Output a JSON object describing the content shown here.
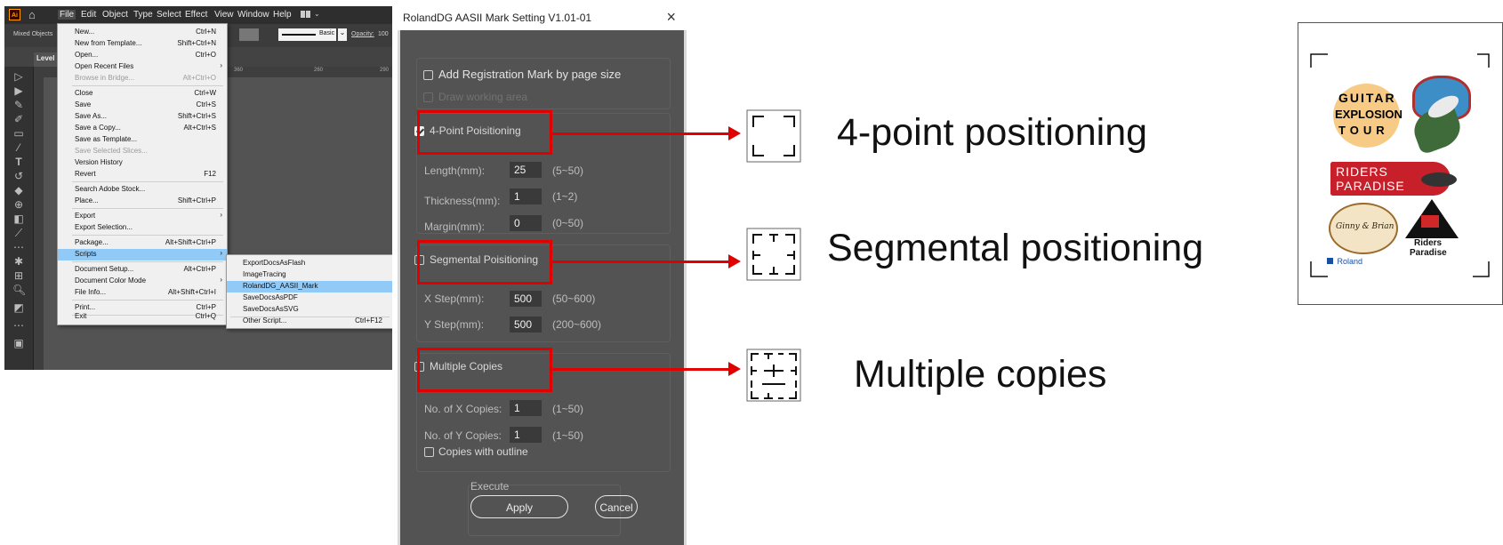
{
  "illustrator": {
    "logo": "Ai",
    "menubar": [
      "File",
      "Edit",
      "Object",
      "Type",
      "Select",
      "Effect",
      "View",
      "Window",
      "Help"
    ],
    "control_bar": {
      "left_label": "Mixed Objects",
      "stroke_style": "Basic",
      "opacity_label": "Opacity:",
      "opacity_value": "100"
    },
    "doc_tab": "Level",
    "ruler_numbers": [
      "360",
      "260",
      "290"
    ],
    "file_menu": [
      {
        "label": "New...",
        "shortcut": "Ctrl+N"
      },
      {
        "label": "New from Template...",
        "shortcut": "Shift+Ctrl+N"
      },
      {
        "label": "Open...",
        "shortcut": "Ctrl+O"
      },
      {
        "label": "Open Recent Files",
        "shortcut": ""
      },
      {
        "label": "Browse in Bridge...",
        "shortcut": "Alt+Ctrl+O"
      },
      {
        "label": "Close",
        "shortcut": "Ctrl+W"
      },
      {
        "label": "Save",
        "shortcut": "Ctrl+S"
      },
      {
        "label": "Save As...",
        "shortcut": "Shift+Ctrl+S"
      },
      {
        "label": "Save a Copy...",
        "shortcut": "Alt+Ctrl+S"
      },
      {
        "label": "Save as Template...",
        "shortcut": ""
      },
      {
        "label": "Save Selected Slices...",
        "shortcut": ""
      },
      {
        "label": "Version History",
        "shortcut": ""
      },
      {
        "label": "Revert",
        "shortcut": "F12"
      },
      {
        "label": "Search Adobe Stock...",
        "shortcut": ""
      },
      {
        "label": "Place...",
        "shortcut": "Shift+Ctrl+P"
      },
      {
        "label": "Export",
        "shortcut": ""
      },
      {
        "label": "Export Selection...",
        "shortcut": ""
      },
      {
        "label": "Package...",
        "shortcut": "Alt+Shift+Ctrl+P"
      },
      {
        "label": "Scripts",
        "shortcut": ""
      },
      {
        "label": "Document Setup...",
        "shortcut": "Alt+Ctrl+P"
      },
      {
        "label": "Document Color Mode",
        "shortcut": ""
      },
      {
        "label": "File Info...",
        "shortcut": "Alt+Shift+Ctrl+I"
      },
      {
        "label": "Print...",
        "shortcut": "Ctrl+P"
      },
      {
        "label": "Exit",
        "shortcut": "Ctrl+Q"
      }
    ],
    "scripts_menu": [
      {
        "label": "ExportDocsAsFlash",
        "shortcut": ""
      },
      {
        "label": "ImageTracing",
        "shortcut": ""
      },
      {
        "label": "RolandDG_AASII_Mark",
        "shortcut": ""
      },
      {
        "label": "SaveDocsAsPDF",
        "shortcut": ""
      },
      {
        "label": "SaveDocsAsSVG",
        "shortcut": ""
      },
      {
        "label": "Other Script...",
        "shortcut": "Ctrl+F12"
      }
    ]
  },
  "dialog": {
    "title": "RolandDG AASII Mark Setting V1.01-01",
    "close_glyph": "×",
    "add_reg_mark": {
      "label": "Add Registration Mark by page size",
      "checked": false
    },
    "draw_working_area": {
      "label": "Draw working area",
      "checked": false
    },
    "four_point": {
      "label": "4-Point Poisitioning",
      "checked": true,
      "fields": [
        {
          "label": "Length(mm):",
          "value": "25",
          "range": "(5~50)"
        },
        {
          "label": "Thickness(mm):",
          "value": "1",
          "range": "(1~2)"
        },
        {
          "label": "Margin(mm):",
          "value": "0",
          "range": "(0~50)"
        }
      ]
    },
    "segmental": {
      "label": "Segmental Poisitioning",
      "checked": false,
      "fields": [
        {
          "label": "X Step(mm):",
          "value": "500",
          "range": "(50~600)"
        },
        {
          "label": "Y Step(mm):",
          "value": "500",
          "range": "(200~600)"
        }
      ]
    },
    "multiple": {
      "label": "Multiple Copies",
      "checked": false,
      "fields": [
        {
          "label": "No. of X Copies:",
          "value": "1",
          "range": "(1~50)"
        },
        {
          "label": "No. of Y Copies:",
          "value": "1",
          "range": "(1~50)"
        }
      ],
      "outline": {
        "label": "Copies with outline",
        "checked": false
      }
    },
    "execute_label": "Execute",
    "apply_label": "Apply",
    "cancel_label": "Cancel"
  },
  "annotations": {
    "four_point": "4-point positioning",
    "segmental": "Segmental positioning",
    "multiple": "Multiple copies",
    "arrow_color": "#e00000"
  },
  "preview": {
    "guitar_logo": [
      "GUITAR",
      "EXPLOSION",
      "TOUR"
    ],
    "riders_logo_1": [
      "RIDERS",
      "PARADISE"
    ],
    "riders_logo_2": [
      "Riders",
      "Paradise"
    ],
    "ginny_logo": "Ginny & Brian",
    "roland_logo": "Roland"
  },
  "colors": {
    "dialog_bg": "#535353",
    "highlight": "#e00000",
    "menu_highlight": "#91c9f7"
  }
}
